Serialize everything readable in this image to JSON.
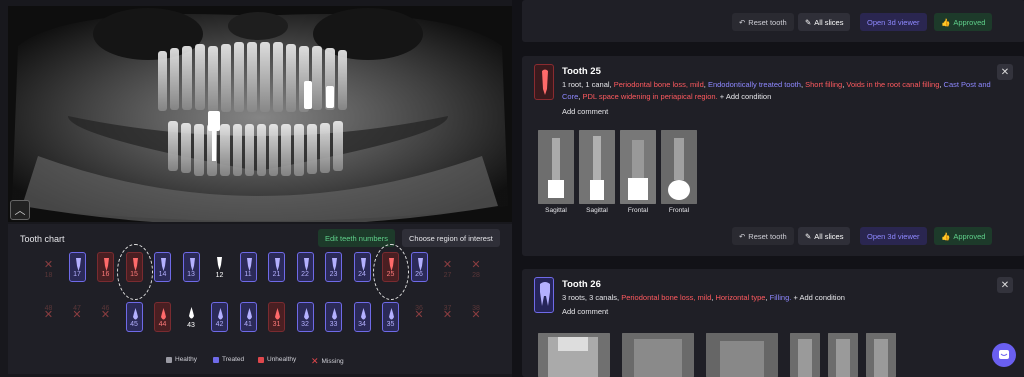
{
  "tooth_chart": {
    "title": "Tooth chart",
    "edit_button": "Edit teeth numbers",
    "roi_button": "Choose region of interest",
    "collapse_icon": "chevron-up-icon",
    "upper_row": [
      {
        "num": "18",
        "status": "missing"
      },
      {
        "num": "17",
        "status": "treated"
      },
      {
        "num": "16",
        "status": "unhealthy"
      },
      {
        "num": "15",
        "status": "unhealthy",
        "circled": true
      },
      {
        "num": "14",
        "status": "treated"
      },
      {
        "num": "13",
        "status": "treated"
      },
      {
        "num": "12",
        "status": "healthy"
      },
      {
        "num": "11",
        "status": "treated"
      },
      {
        "num": "21",
        "status": "treated"
      },
      {
        "num": "22",
        "status": "treated"
      },
      {
        "num": "23",
        "status": "treated"
      },
      {
        "num": "24",
        "status": "treated"
      },
      {
        "num": "25",
        "status": "unhealthy",
        "circled": true
      },
      {
        "num": "26",
        "status": "treated"
      },
      {
        "num": "27",
        "status": "missing"
      },
      {
        "num": "28",
        "status": "missing"
      }
    ],
    "lower_row": [
      {
        "num": "48",
        "status": "missing"
      },
      {
        "num": "47",
        "status": "missing"
      },
      {
        "num": "46",
        "status": "missing"
      },
      {
        "num": "45",
        "status": "treated"
      },
      {
        "num": "44",
        "status": "unhealthy"
      },
      {
        "num": "43",
        "status": "healthy"
      },
      {
        "num": "42",
        "status": "treated"
      },
      {
        "num": "41",
        "status": "treated"
      },
      {
        "num": "31",
        "status": "unhealthy"
      },
      {
        "num": "32",
        "status": "treated"
      },
      {
        "num": "33",
        "status": "treated"
      },
      {
        "num": "34",
        "status": "treated"
      },
      {
        "num": "35",
        "status": "treated"
      },
      {
        "num": "36",
        "status": "missing"
      },
      {
        "num": "37",
        "status": "missing"
      },
      {
        "num": "38",
        "status": "missing"
      }
    ],
    "legend": [
      {
        "label": "Healthy",
        "color": "#9a9aa3"
      },
      {
        "label": "Treated",
        "color": "#6f6ae8"
      },
      {
        "label": "Unhealthy",
        "color": "#e0474c"
      },
      {
        "label": "Missing",
        "color": "#e0474c"
      }
    ]
  },
  "top_actions": {
    "reset": "Reset tooth",
    "slices": "All slices",
    "viewer": "Open 3d viewer",
    "approved": "Approved"
  },
  "card25": {
    "title": "Tooth 25",
    "roots": "1 root,  1 canal,",
    "conditions": [
      {
        "text": "Periodontal bone loss, mild",
        "color": "red"
      },
      {
        "text": "Endodontically treated tooth",
        "color": "purple"
      },
      {
        "text": "Short filling",
        "color": "red"
      },
      {
        "text": "Voids in the root canal filling",
        "color": "red"
      },
      {
        "text": "Cast Post and Core",
        "color": "purple"
      },
      {
        "text": "PDL space widening in periapical region.",
        "color": "red"
      }
    ],
    "add_condition": "+ Add condition",
    "add_comment": "Add comment",
    "thumbs": [
      "Sagittal",
      "Sagittal",
      "Frontal",
      "Frontal"
    ],
    "reset": "Reset tooth",
    "slices": "All slices",
    "viewer": "Open 3d viewer",
    "approved": "Approved"
  },
  "card26": {
    "title": "Tooth 26",
    "roots": "3 roots,  3 canals,",
    "conditions": [
      {
        "text": "Periodontal bone loss, mild",
        "color": "red"
      },
      {
        "text": "Horizontal type",
        "color": "red"
      },
      {
        "text": "Filling.",
        "color": "purple"
      }
    ],
    "add_condition": "+ Add condition",
    "add_comment": "Add comment"
  },
  "colors": {
    "red": "#ff5a5f",
    "purple": "#8e88ff",
    "green": "#5fd08a",
    "accent": "#6a5ff0"
  }
}
